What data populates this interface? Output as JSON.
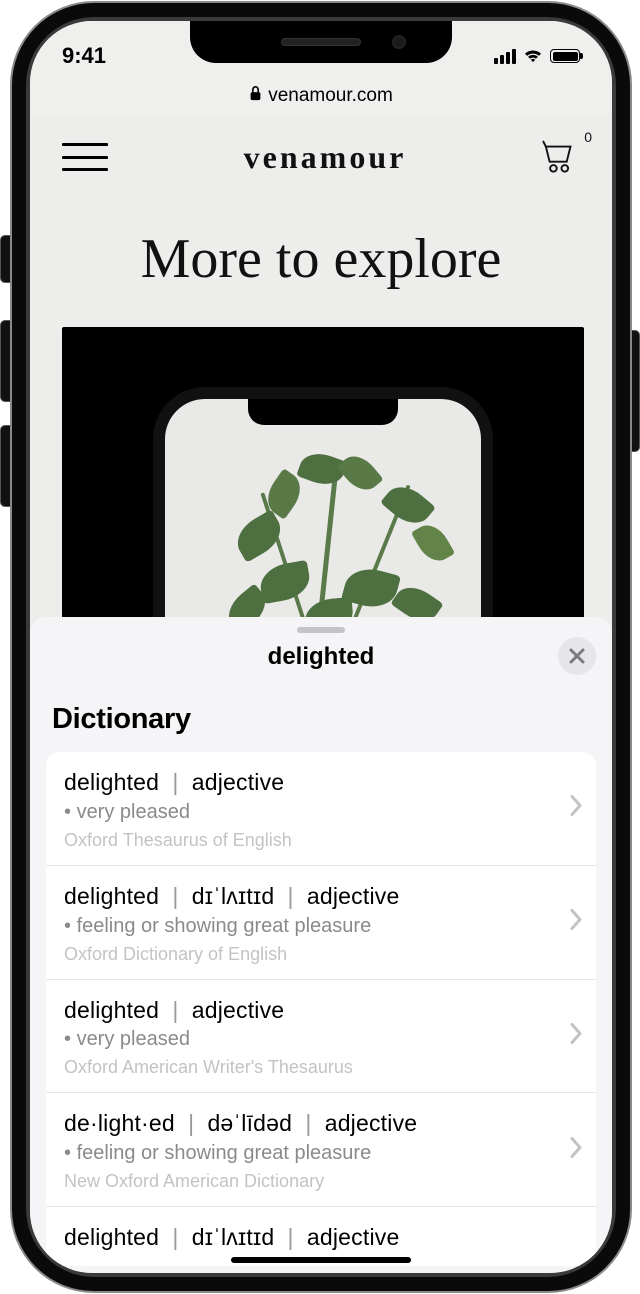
{
  "status_bar": {
    "time": "9:41"
  },
  "browser": {
    "domain": "venamour.com"
  },
  "site": {
    "logo_text": "venamour",
    "cart_count": "0",
    "hero_title": "More to explore"
  },
  "lookup": {
    "word": "delighted",
    "section_title": "Dictionary",
    "entries": [
      {
        "headword": "delighted",
        "pronunciation": "",
        "pos": "adjective",
        "definition": "very pleased",
        "source": "Oxford Thesaurus of English"
      },
      {
        "headword": "delighted",
        "pronunciation": "dɪˈlʌɪtɪd",
        "pos": "adjective",
        "definition": "feeling or showing great pleasure",
        "source": "Oxford Dictionary of English"
      },
      {
        "headword": "delighted",
        "pronunciation": "",
        "pos": "adjective",
        "definition": "very pleased",
        "source": "Oxford American Writer's Thesaurus"
      },
      {
        "headword": "de·light·ed",
        "pronunciation": "dəˈlīdəd",
        "pos": "adjective",
        "definition": "feeling or showing great pleasure",
        "source": "New Oxford American Dictionary"
      },
      {
        "headword": "delighted",
        "pronunciation": "dɪˈlʌɪtɪd",
        "pos": "adjective",
        "definition": "",
        "source": ""
      }
    ]
  }
}
